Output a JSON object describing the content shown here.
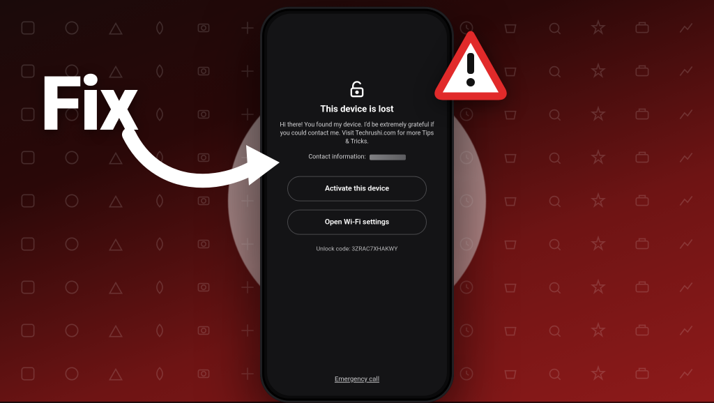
{
  "overlay": {
    "fix_text": "Fix"
  },
  "phone": {
    "title": "This device is lost",
    "message": "Hi there! You found my device. I'd be extremely grateful if you could contact me. Visit Techrushi.com for more Tips & Tricks.",
    "contact_label": "Contact information:",
    "activate_btn": "Activate this device",
    "wifi_btn": "Open Wi-Fi settings",
    "unlock_label": "Unlock code: 3ZRAC7XHAKWY",
    "emergency": "Emergency call"
  }
}
